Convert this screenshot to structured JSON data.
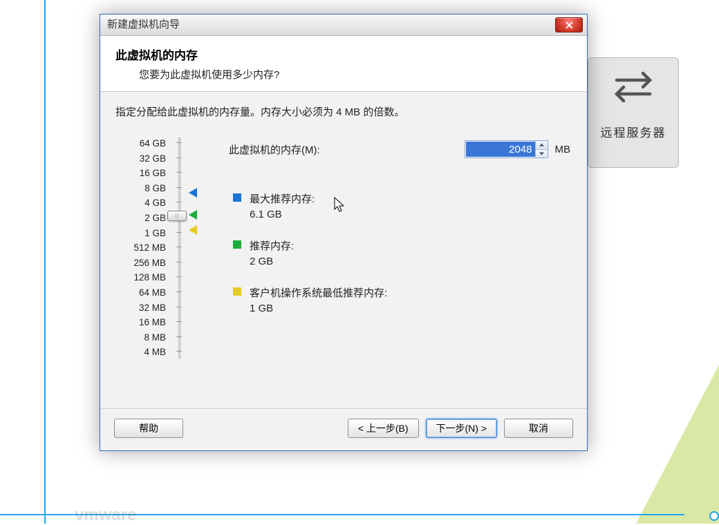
{
  "bg": {
    "remote_label": "远程服务器",
    "brand": "vmware"
  },
  "dialog": {
    "title": "新建虚拟机向导",
    "header_title": "此虚拟机的内存",
    "header_subtitle": "您要为此虚拟机使用多少内存?",
    "instruction": "指定分配给此虚拟机的内存量。内存大小必须为 4 MB 的倍数。",
    "memory_label": "此虚拟机的内存(M):",
    "memory_value": "2048",
    "memory_unit": "MB",
    "slider_ticks": [
      "64 GB",
      "32 GB",
      "16 GB",
      "8 GB",
      "4 GB",
      "2 GB",
      "1 GB",
      "512 MB",
      "256 MB",
      "128 MB",
      "64 MB",
      "32 MB",
      "16 MB",
      "8 MB",
      "4 MB"
    ],
    "recommendations": [
      {
        "color": "blue",
        "title": "最大推荐内存:",
        "value": "6.1 GB"
      },
      {
        "color": "green",
        "title": "推荐内存:",
        "value": "2 GB"
      },
      {
        "color": "yellow",
        "title": "客户机操作系统最低推荐内存:",
        "value": "1 GB"
      }
    ],
    "buttons": {
      "help": "帮助",
      "back": "< 上一步(B)",
      "next": "下一步(N) >",
      "cancel": "取消"
    }
  }
}
